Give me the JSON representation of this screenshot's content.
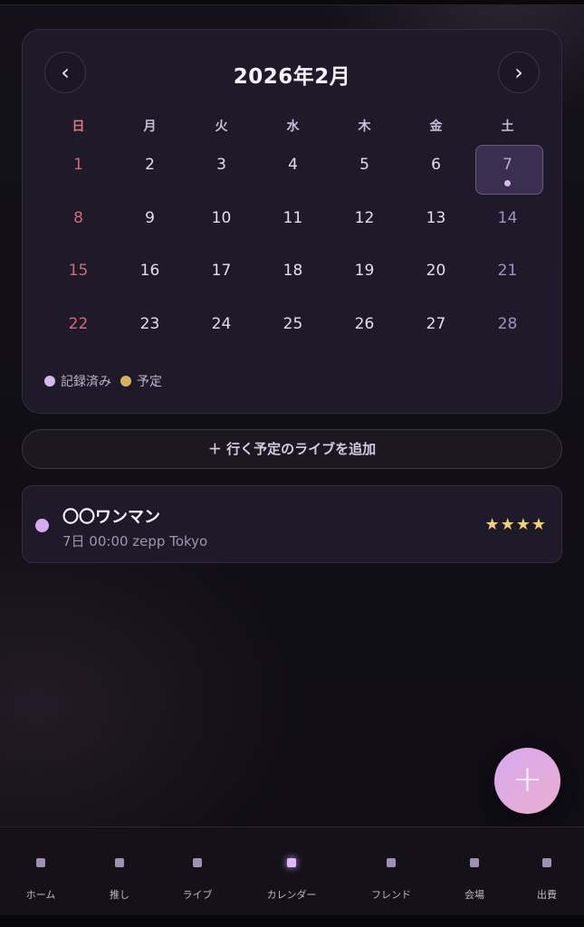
{
  "calendar": {
    "title": "2026年2月",
    "prev_icon": "‹",
    "next_icon": "›",
    "weekdays": [
      "日",
      "月",
      "火",
      "水",
      "木",
      "金",
      "土"
    ],
    "weeks": [
      [
        "1",
        "2",
        "3",
        "4",
        "5",
        "6",
        "7"
      ],
      [
        "8",
        "9",
        "10",
        "11",
        "12",
        "13",
        "14"
      ],
      [
        "15",
        "16",
        "17",
        "18",
        "19",
        "20",
        "21"
      ],
      [
        "22",
        "23",
        "24",
        "25",
        "26",
        "27",
        "28"
      ]
    ],
    "selected_day": "7",
    "days_with_records": [
      "7"
    ],
    "legend": [
      {
        "label": "記録済み",
        "color": "#d8b7f2"
      },
      {
        "label": "予定",
        "color": "#d9b15c"
      }
    ]
  },
  "add_plan_button": {
    "label": "＋ 行く予定のライブを追加"
  },
  "events": [
    {
      "title": "〇〇ワンマン",
      "subtitle": "7日 00:00 zepp Tokyo",
      "stars": "★★★★",
      "rating": 4,
      "dot_color": "#d6abf0"
    }
  ],
  "fab": {
    "label": "+",
    "icon": "plus-icon"
  },
  "bottom_nav": {
    "items": [
      {
        "label": "ホーム",
        "active": false
      },
      {
        "label": "推し",
        "active": false
      },
      {
        "label": "ライブ",
        "active": false
      },
      {
        "label": "カレンダー",
        "active": true
      },
      {
        "label": "フレンド",
        "active": false
      },
      {
        "label": "会場",
        "active": false
      },
      {
        "label": "出費",
        "active": false
      }
    ]
  },
  "colors": {
    "accent": "#d8b7f2",
    "sunday": "#cf6a78",
    "saturday": "#9d94c4",
    "star": "#f3cf70",
    "card_bg": "#1f1a2a"
  }
}
